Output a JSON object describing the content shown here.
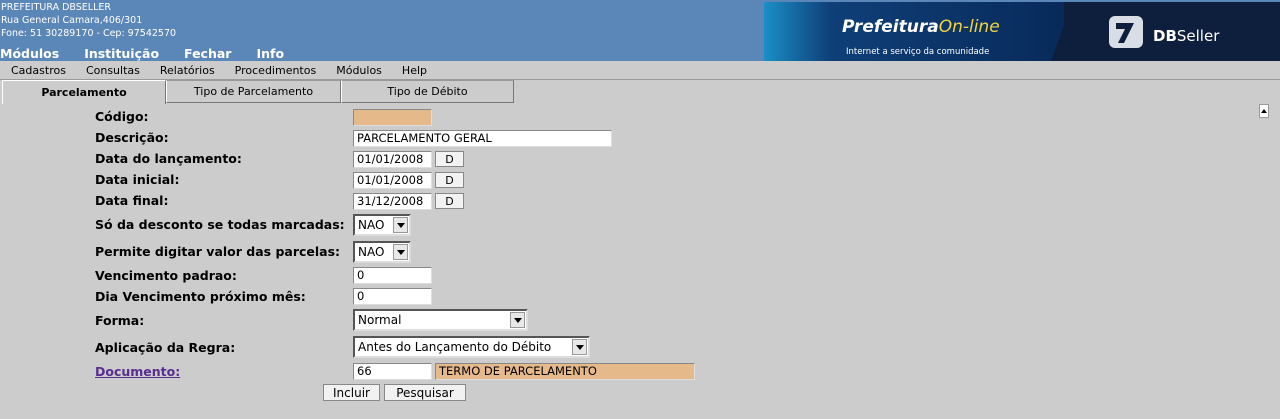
{
  "header": {
    "company": "PREFEITURA DBSELLER",
    "address": "Rua General Camara,406/301",
    "contact": "Fone: 51 30289170  -  Cep: 97542570",
    "nav": [
      "Módulos",
      "Instituição",
      "Fechar",
      "Info"
    ],
    "banner": {
      "prefeitura": "Prefeitura",
      "online": "On-line",
      "slogan": "Internet a serviço da comunidade",
      "db": "DB",
      "seller": "Seller"
    }
  },
  "menubar": [
    "Cadastros",
    "Consultas",
    "Relatórios",
    "Procedimentos",
    "Módulos",
    "Help"
  ],
  "tabs": [
    {
      "label": "Parcelamento",
      "active": true
    },
    {
      "label": "Tipo de Parcelamento",
      "active": false
    },
    {
      "label": "Tipo de Débito",
      "active": false
    }
  ],
  "form": {
    "codigo": {
      "label": "Código:",
      "value": ""
    },
    "descricao": {
      "label": "Descrição:",
      "value": "PARCELAMENTO GERAL"
    },
    "data_lancamento": {
      "label": "Data do lançamento:",
      "value": "01/01/2008",
      "button": "D"
    },
    "data_inicial": {
      "label": "Data inicial:",
      "value": "01/01/2008",
      "button": "D"
    },
    "data_final": {
      "label": "Data final:",
      "value": "31/12/2008",
      "button": "D"
    },
    "so_desconto": {
      "label": "Só da desconto se todas marcadas:",
      "value": "NAO"
    },
    "permite_digitar": {
      "label": "Permite digitar valor das parcelas:",
      "value": "NAO"
    },
    "vencimento_padrao": {
      "label": "Vencimento padrao:",
      "value": "0"
    },
    "dia_vencimento": {
      "label": "Dia Vencimento próximo mês:",
      "value": "0"
    },
    "forma": {
      "label": "Forma:",
      "value": "Normal"
    },
    "aplicacao_regra": {
      "label": "Aplicação da Regra:",
      "value": "Antes do Lançamento do Débito"
    },
    "documento": {
      "label": "Documento:",
      "code": "66",
      "description": "TERMO DE PARCELAMENTO"
    }
  },
  "actions": {
    "incluir": "Incluir",
    "pesquisar": "Pesquisar"
  },
  "colors": {
    "header_bg": "#5b86b8",
    "page_bg": "#cccccc",
    "readonly_field": "#e6b98a",
    "link": "#5a2d91"
  }
}
